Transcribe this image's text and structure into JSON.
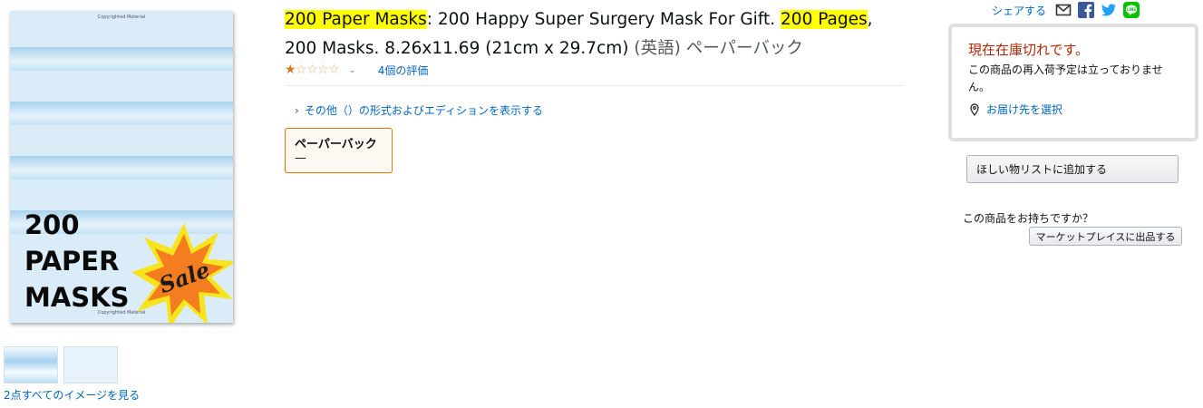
{
  "product": {
    "cover": {
      "title_lines": [
        "200",
        "PAPER",
        "MASKS"
      ],
      "sale_text": "Sale",
      "watermark": "Copyrighted Material",
      "accent_color": "#f47d20"
    },
    "title": {
      "part1": "200 Paper Masks",
      "part2": ": 200 Happy Super Surgery Mask For Gift. ",
      "part3": "200 Pages",
      "part4": ", 200 Masks. 8.26x11.69 (21cm x 29.7cm) ",
      "format_suffix": "(英語) ペーパーバック"
    },
    "rating": {
      "stars_filled": 1,
      "stars_total": 5,
      "reviews_link": "4個の評価"
    },
    "other_formats_link": "その他（）の形式およびエディションを表示する",
    "format_option": {
      "name": "ペーパーバック",
      "price": "—"
    },
    "see_all_images": "2点すべてのイメージを見る"
  },
  "share": {
    "label": "シェアする",
    "icons": [
      "email-icon",
      "facebook-icon",
      "twitter-icon",
      "line-icon"
    ]
  },
  "buybox": {
    "status": "現在在庫切れです。",
    "message": "この商品の再入荷予定は立っておりません。",
    "deliver_link": "お届け先を選択",
    "wishlist_button": "ほしい物リストに追加する",
    "own_question": "この商品をお持ちですか？",
    "sell_button": "マーケットプレイスに出品する"
  },
  "colors": {
    "link": "#0066c0",
    "out_of_stock": "#b12704",
    "highlight": "#ffff00",
    "selected_border": "#e77600",
    "star": "#de7921"
  }
}
